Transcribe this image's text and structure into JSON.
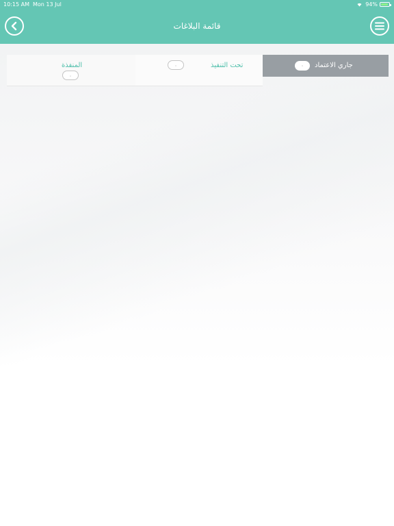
{
  "status_bar": {
    "time": "10:15 AM",
    "date": "Mon 13 Jul",
    "battery": "94%"
  },
  "header": {
    "title": "قائمة البلاغات",
    "back_icon": "chevron-left-icon",
    "menu_icon": "hamburger-menu-icon"
  },
  "tabs": [
    {
      "label": "جاري الاعتماد",
      "count": "٠",
      "selected": true
    },
    {
      "label": "تحت التنفيذ",
      "count": "٠",
      "selected": false
    },
    {
      "label": "المنفذة",
      "count": "٠",
      "selected": false
    }
  ],
  "colors": {
    "header": "#64c6b4",
    "tab_selected": "#989ea3",
    "tab_text": "#4fbfab"
  }
}
